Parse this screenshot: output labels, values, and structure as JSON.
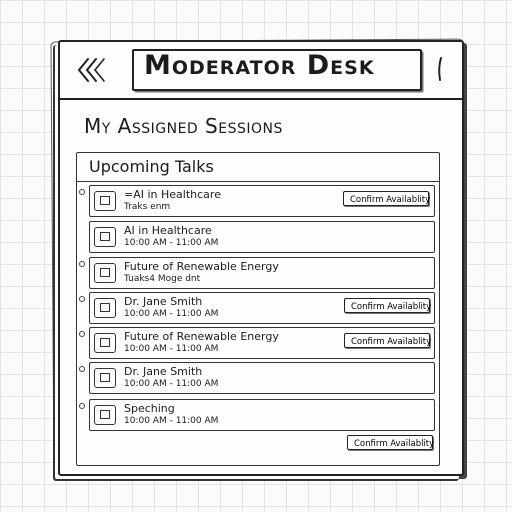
{
  "header": {
    "title": "Moderator Desk",
    "back_icon": "double-chevron-left-icon",
    "menu_icon": "menu-handle-icon"
  },
  "page": {
    "heading": "My Assigned Sessions"
  },
  "panel": {
    "title": "Upcoming Talks",
    "sessions": [
      {
        "title": "=AI in Healthcare",
        "subtitle": "Traks enm",
        "confirm_label": "Confirm Availablity"
      },
      {
        "title": "AI in Healthcare",
        "subtitle": "10:00 AM - 11:00 AM",
        "confirm_label": ""
      },
      {
        "title": "Future of Renewable Energy",
        "subtitle": "Tuaks4 Moge dnt",
        "confirm_label": ""
      },
      {
        "title": "Dr. Jane Smith",
        "subtitle": "10:00 AM - 11:00 AM",
        "confirm_label": "Confirm Availablity"
      },
      {
        "title": "Future of Renewable Energy",
        "subtitle": "10:00 AM - 11:00 AM",
        "confirm_label": "Confirm Availablity"
      },
      {
        "title": "Dr. Jane Smith",
        "subtitle": "10:00 AM - 11:00 AM",
        "confirm_label": ""
      },
      {
        "title": "Speching",
        "subtitle": "10:00 AM - 11:00 AM",
        "confirm_label": ""
      }
    ],
    "footer_confirm_label": "Confirm Availablity"
  },
  "colors": {
    "ink": "#1c1c1c",
    "paper": "#fdfdfd",
    "grid": "#e4e4e4"
  }
}
